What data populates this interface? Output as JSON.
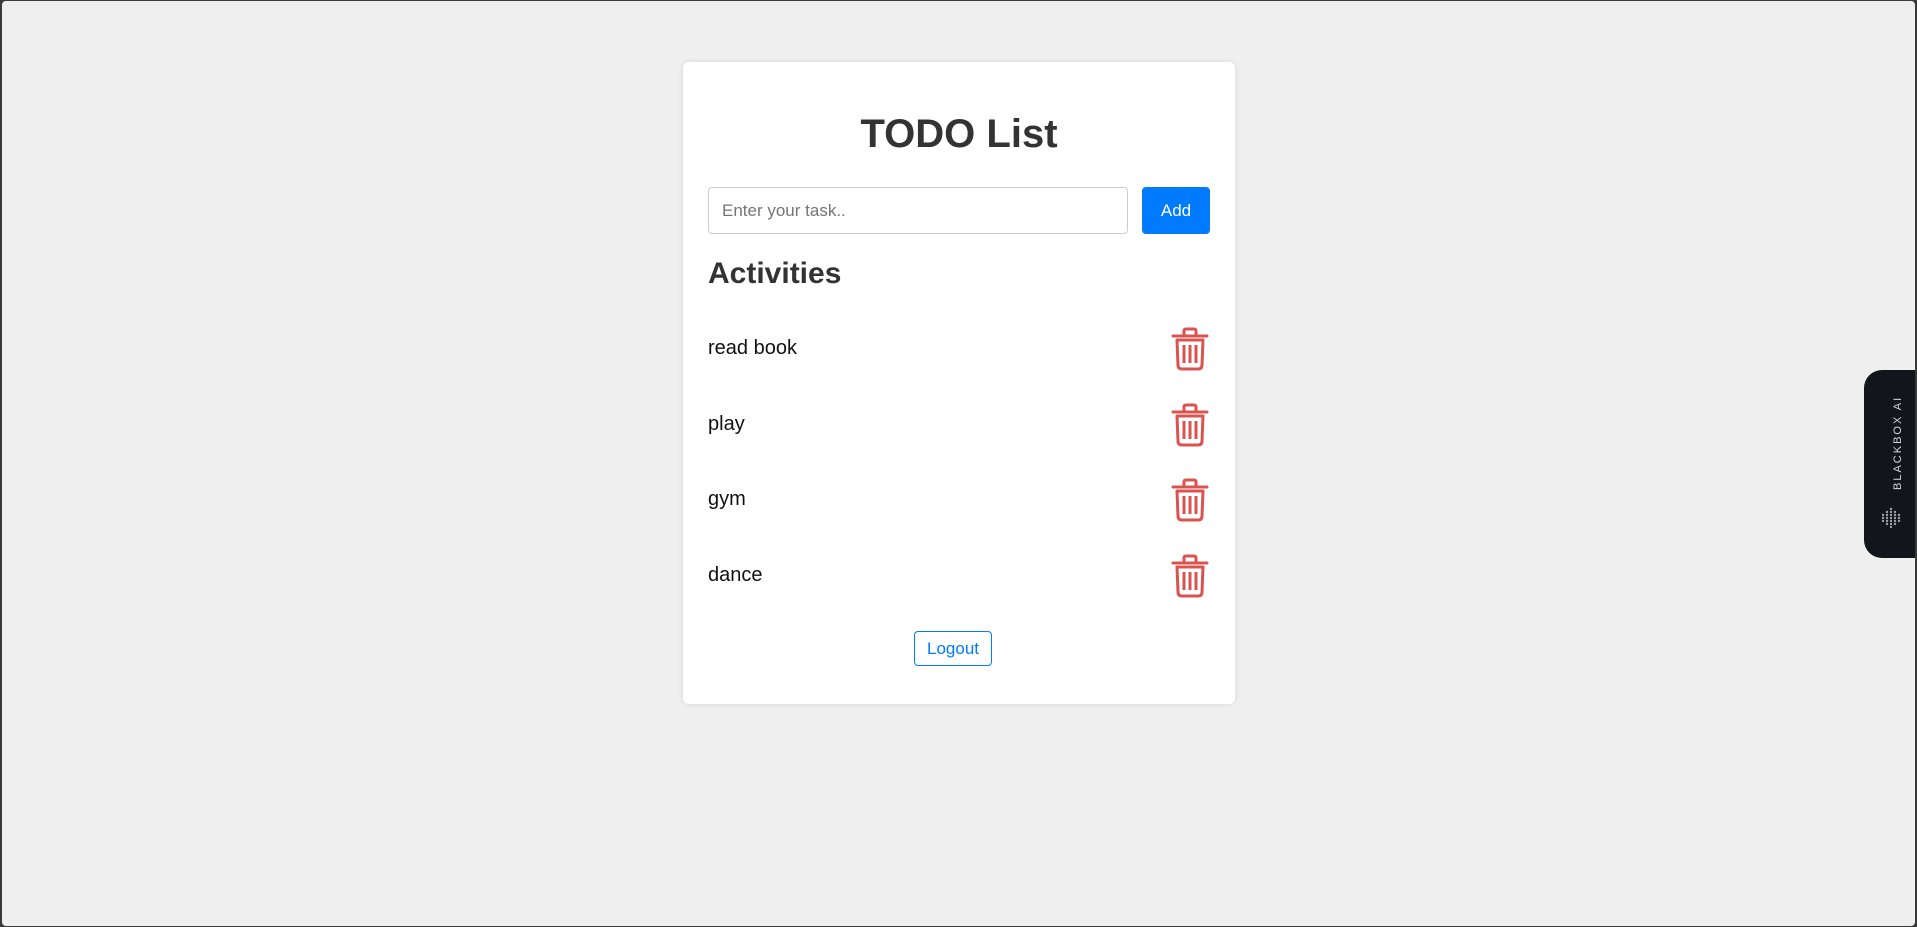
{
  "app": {
    "title": "TODO List"
  },
  "task_form": {
    "input_value": "",
    "input_placeholder": "Enter your task..",
    "add_label": "Add"
  },
  "activities": {
    "heading": "Activities",
    "items": [
      {
        "label": "read book",
        "delete_icon": "trash-icon"
      },
      {
        "label": "play",
        "delete_icon": "trash-icon"
      },
      {
        "label": "gym",
        "delete_icon": "trash-icon"
      },
      {
        "label": "dance",
        "delete_icon": "trash-icon"
      }
    ]
  },
  "logout_label": "Logout",
  "side_widget": {
    "label": "BLACKBOX AI",
    "icon": "blackbox-logo-icon"
  },
  "colors": {
    "accent": "#007bff",
    "delete": "#d9534f",
    "page_background": "#efefef",
    "card_background": "#ffffff",
    "side_widget_background": "#12151b"
  }
}
